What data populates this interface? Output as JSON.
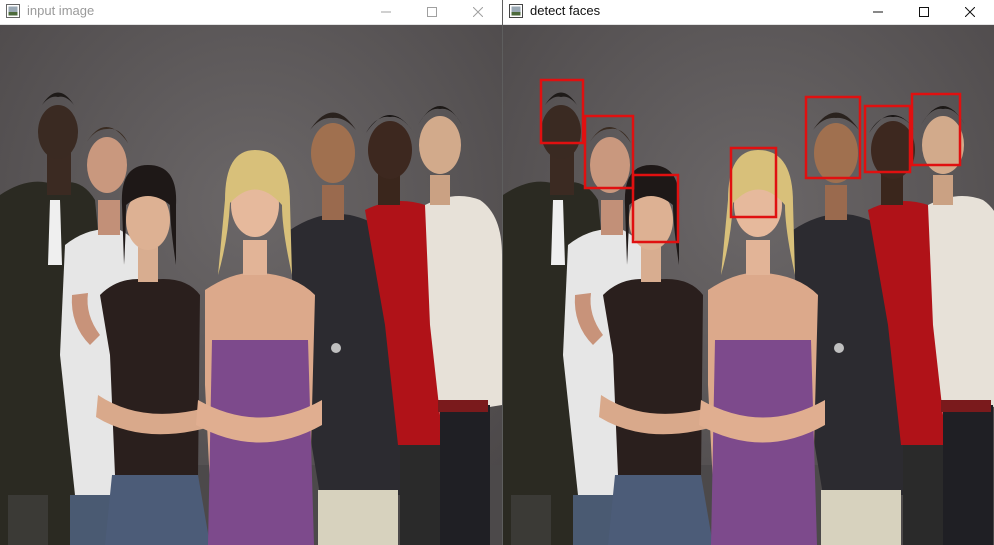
{
  "windows": {
    "input": {
      "title": "input image",
      "controls": {
        "minimize": "minimize-icon",
        "maximize": "maximize-icon",
        "close": "close-icon"
      }
    },
    "detect": {
      "title": "detect faces",
      "controls": {
        "minimize": "minimize-icon",
        "maximize": "maximize-icon",
        "close": "close-icon"
      }
    }
  },
  "colors": {
    "detection_box": "#e01010",
    "background": "#5f5b5c",
    "inactive_title": "#9a9a9a",
    "active_title": "#111111"
  },
  "detections": {
    "count": 7,
    "box_color": "#e01010"
  }
}
